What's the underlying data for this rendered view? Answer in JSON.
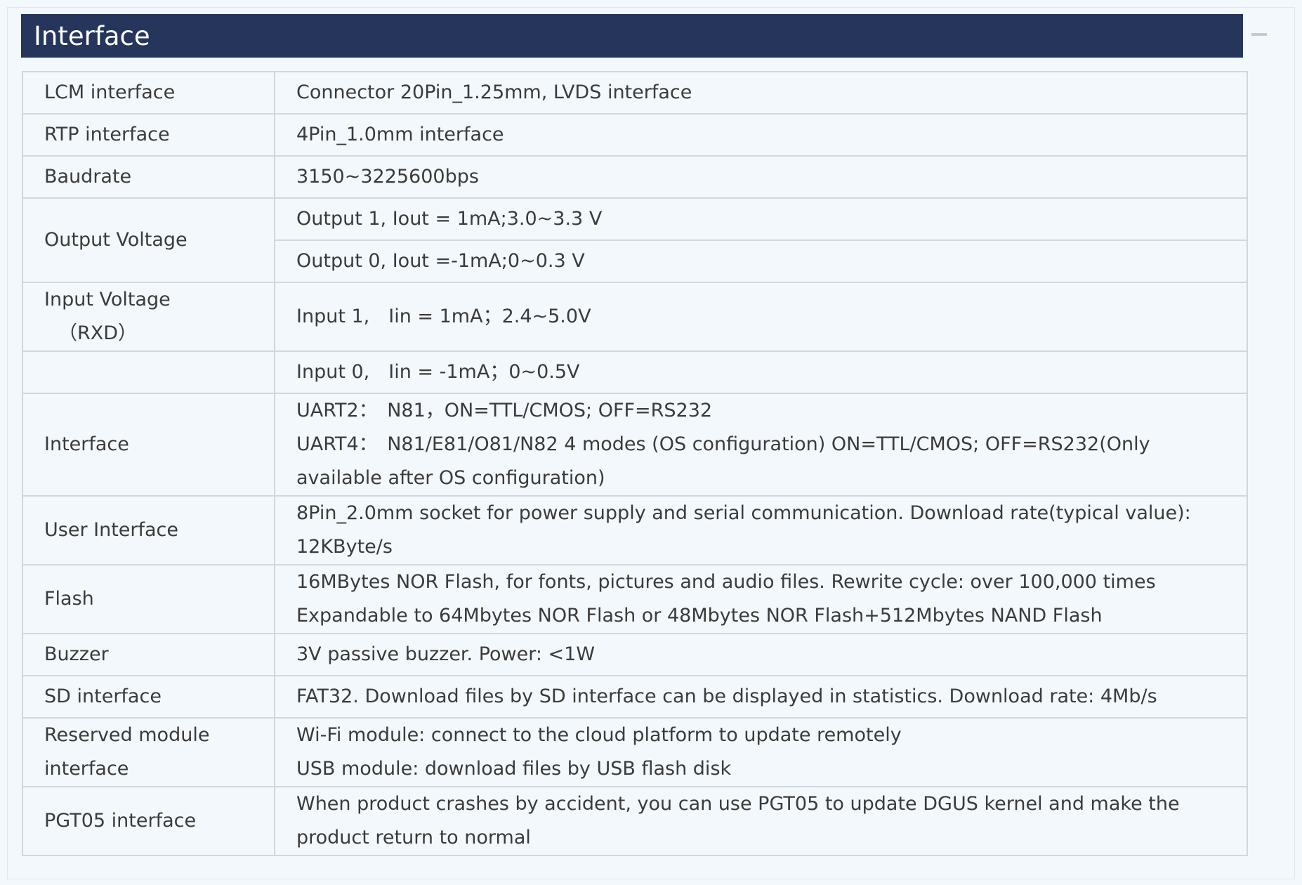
{
  "header": {
    "title": "Interface"
  },
  "rows": [
    {
      "label": "LCM interface",
      "value": "Connector 20Pin_1.25mm, LVDS interface"
    },
    {
      "label": "RTP interface",
      "value": "4Pin_1.0mm interface"
    },
    {
      "label": "Baudrate",
      "value": "3150~3225600bps"
    },
    {
      "label": "Output Voltage",
      "value": "Output 1, Iout = 1mA;3.0~3.3 V",
      "value2": "Output 0, Iout =-1mA;0~0.3 V"
    },
    {
      "label": "Input Voltage",
      "label2": "（RXD）",
      "value": "Input 1,　Iin = 1mA；2.4~5.0V"
    },
    {
      "label": "",
      "value": "Input 0,　Iin = -1mA；0~0.5V"
    },
    {
      "label": "Interface",
      "lines": [
        "UART2：　N81，ON=TTL/CMOS; OFF=RS232",
        "UART4：　N81/E81/O81/N82 4 modes (OS configuration) ON=TTL/CMOS; OFF=RS232(Only available after OS configuration)"
      ]
    },
    {
      "label": "User Interface",
      "value": "8Pin_2.0mm socket for power supply and serial communication. Download rate(typical value): 12KByte/s"
    },
    {
      "label": "Flash",
      "lines": [
        "16MBytes NOR Flash, for fonts, pictures and audio files. Rewrite cycle: over 100,000 times",
        "Expandable to 64Mbytes NOR Flash or 48Mbytes NOR Flash+512Mbytes NAND Flash"
      ]
    },
    {
      "label": "Buzzer",
      "value": "3V passive buzzer. Power: <1W"
    },
    {
      "label": "SD interface",
      "value": "FAT32. Download files by SD interface can be displayed in statistics. Download rate: 4Mb/s"
    },
    {
      "label": "Reserved module interface",
      "lines": [
        "Wi-Fi module: connect to the cloud platform to update remotely",
        "USB module: download files by USB flash disk"
      ]
    },
    {
      "label": "PGT05 interface",
      "value": "When product crashes by accident, you can use PGT05 to update DGUS kernel and make the product return to normal"
    }
  ]
}
